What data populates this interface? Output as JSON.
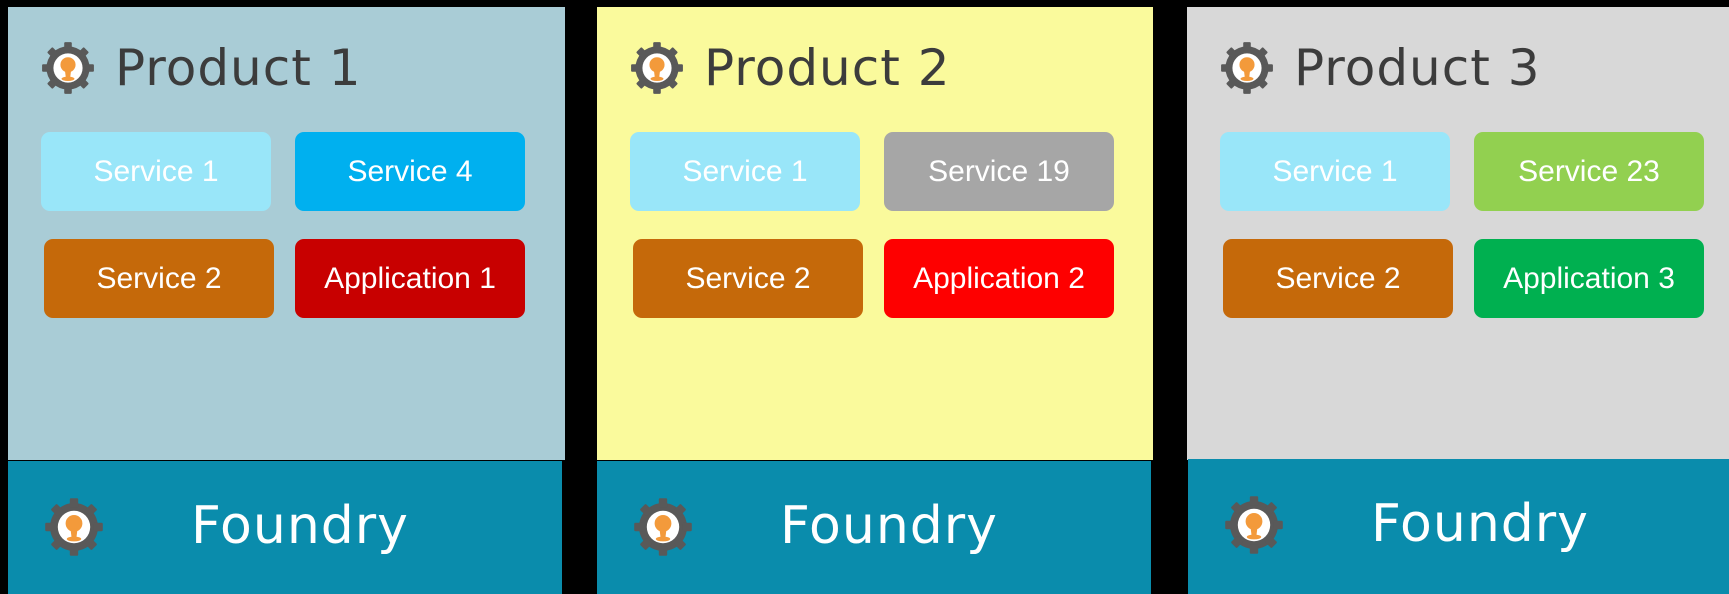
{
  "colors": {
    "background": "#000000",
    "foundry_bg": "#0a8cac",
    "logo_gear": "#595959",
    "logo_person": "#f39a3b"
  },
  "logo_icon": "gear-person-icon",
  "products": [
    {
      "title": "Product 1",
      "bg": "#a9ccd6",
      "tiles": [
        {
          "label": "Service 1",
          "color": "#99e6f9"
        },
        {
          "label": "Service 4",
          "color": "#00b0ef"
        },
        {
          "label": "Service 2",
          "color": "#c5690a"
        },
        {
          "label": "Application 1",
          "color": "#c80000"
        }
      ],
      "foundry": "Foundry"
    },
    {
      "title": "Product 2",
      "bg": "#fafa9c",
      "tiles": [
        {
          "label": "Service 1",
          "color": "#99e6f9"
        },
        {
          "label": "Service 19",
          "color": "#a6a6a6"
        },
        {
          "label": "Service 2",
          "color": "#c5690a"
        },
        {
          "label": "Application 2",
          "color": "#fe0000"
        }
      ],
      "foundry": "Foundry"
    },
    {
      "title": "Product 3",
      "bg": "#d8d8d8",
      "tiles": [
        {
          "label": "Service 1",
          "color": "#99e6f9"
        },
        {
          "label": "Service 23",
          "color": "#92d050"
        },
        {
          "label": "Service 2",
          "color": "#c5690a"
        },
        {
          "label": "Application 3",
          "color": "#00b050"
        }
      ],
      "foundry": "Foundry"
    }
  ]
}
